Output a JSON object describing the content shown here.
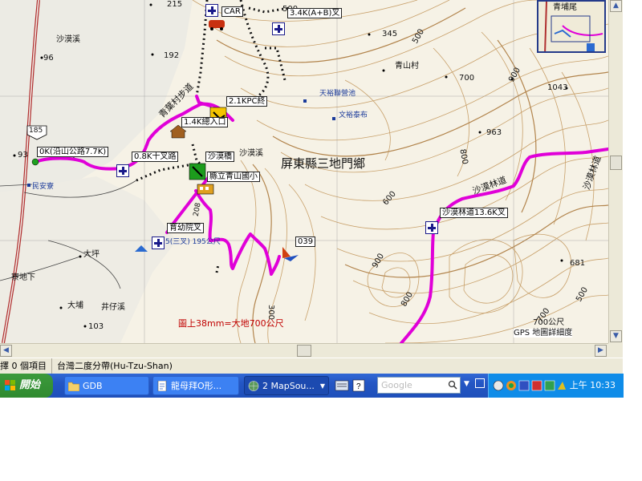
{
  "map": {
    "region_label": "屏東縣三地門鄉",
    "scale_note": "圖上38mm=大地700公尺",
    "scale_bar": "700公尺",
    "gps_note": "GPS 地圖詳細度",
    "inset_label": "青埔尾",
    "places": {
      "shamoxi_w": "沙漠溪",
      "shamoxi_mid": "沙漠溪",
      "qingshancun": "青山村",
      "daping": "大坪",
      "liaodixia": "寮地下",
      "dapu": "大埔",
      "jingzixi": "井仔溪",
      "minanxiang": "民安寮",
      "tianxingchibei": "天裕聯營池",
      "wenhuaxi": "文裕泰布",
      "shanlin_bridge": "沙漠橋",
      "shasha_forest_road": "沙漠林道",
      "sha_zi_road_right": "沙漠林道",
      "qingshan_trail": "青葉村步道",
      "elem_school": "縣立青山國小"
    },
    "box_labels": {
      "car": "CAR",
      "k34": "3.4K(A+B)叉",
      "k21": "2.1KPC終",
      "k14": "1.4K總入口",
      "k0": "0K(沿山公路7.7K)",
      "k08": "0.8K十叉路",
      "shamo_bridge": "沙漠橋",
      "school": "縣立青山國小",
      "nursery": "育幼院叉",
      "k036_road": "沙漠林道13.6K叉",
      "wp039": "039"
    },
    "road_number": "185",
    "blue_note": "5(三叉) 195公尺",
    "road_code": "208",
    "elevations": {
      "e215": "215",
      "e345": "345",
      "e500a": "500",
      "e500b": "500",
      "e700a": "700",
      "e900a": "900",
      "e1043": "1043",
      "e96": "96",
      "e192": "192",
      "e93": "93",
      "e963": "963",
      "e800a": "800",
      "e600": "600",
      "e900b": "900",
      "e800b": "800",
      "e681": "681",
      "e103": "103",
      "e300": "300",
      "e700b": "700",
      "e500c": "500"
    }
  },
  "status_bar": {
    "selection": "擇 0 個項目",
    "projection": "台灣二度分帶(Hu-Tzu-Shan)"
  },
  "taskbar": {
    "start": "開始",
    "tasks": [
      "GDB",
      "龍母拜O形...",
      "2 MapSou..."
    ],
    "search_placeholder": "Google",
    "clock": "上午 10:33"
  }
}
